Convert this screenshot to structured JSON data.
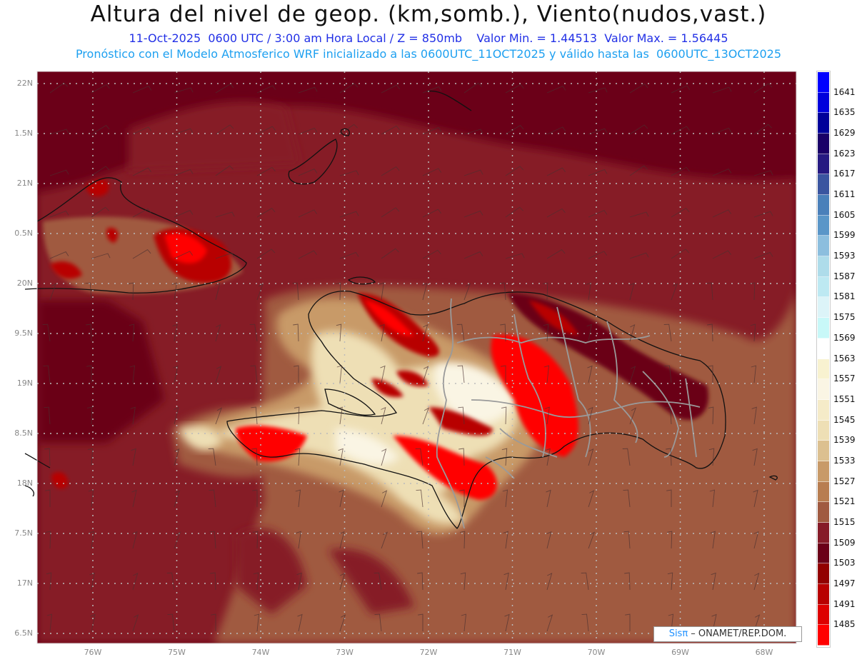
{
  "header": {
    "title": "Altura del nivel de geop. (km,somb.), Viento(nudos,vast.)",
    "subtitle1": "11-Oct-2025  0600 UTC / 3:00 am Hora Local / Z = 850mb    Valor Min. = 1.44513  Valor Max. = 1.56445",
    "subtitle2": "Pronóstico con el Modelo Atmosferico WRF inicializado a las 0600UTC_11OCT2025 y válido hasta las  0600UTC_13OCT2025"
  },
  "map": {
    "lat_labels": [
      {
        "lat": 22,
        "text": "22N"
      },
      {
        "lat": 21.5,
        "text": "1.5N"
      },
      {
        "lat": 21,
        "text": "21N"
      },
      {
        "lat": 20.5,
        "text": "0.5N"
      },
      {
        "lat": 20,
        "text": "20N"
      },
      {
        "lat": 19.5,
        "text": "9.5N"
      },
      {
        "lat": 19,
        "text": "19N"
      },
      {
        "lat": 18.5,
        "text": "8.5N"
      },
      {
        "lat": 18,
        "text": "18N"
      },
      {
        "lat": 17.5,
        "text": "7.5N"
      },
      {
        "lat": 17,
        "text": "17N"
      },
      {
        "lat": 16.5,
        "text": "6.5N"
      }
    ],
    "lon_labels": [
      {
        "lon": -76,
        "text": "76W"
      },
      {
        "lon": -75,
        "text": "75W"
      },
      {
        "lon": -74,
        "text": "74W"
      },
      {
        "lon": -73,
        "text": "73W"
      },
      {
        "lon": -72,
        "text": "72W"
      },
      {
        "lon": -71,
        "text": "71W"
      },
      {
        "lon": -70,
        "text": "70W"
      },
      {
        "lon": -69,
        "text": "69W"
      },
      {
        "lon": -68,
        "text": "68W"
      }
    ],
    "icon": "wind-barb-icon"
  },
  "colorbar": {
    "labels": [
      "1641",
      "1635",
      "1629",
      "1623",
      "1617",
      "1611",
      "1605",
      "1599",
      "1593",
      "1587",
      "1581",
      "1575",
      "1569",
      "1563",
      "1557",
      "1551",
      "1545",
      "1539",
      "1533",
      "1527",
      "1521",
      "1515",
      "1509",
      "1503",
      "1497",
      "1491",
      "1485"
    ],
    "colors": [
      "#0000ff",
      "#0000dc",
      "#00009a",
      "#1a0068",
      "#261a82",
      "#3a55a0",
      "#4a80ba",
      "#5a96c8",
      "#8cbede",
      "#aedcea",
      "#bde9f2",
      "#dcf4f8",
      "#c8f8f8",
      "#ffffff",
      "#f8f2d0",
      "#faf5e4",
      "#f5ebc8",
      "#eedfb5",
      "#dcc090",
      "#c89a68",
      "#b87d50",
      "#a05a40",
      "#861b28",
      "#6b0018",
      "#920000",
      "#b80000",
      "#dd0000",
      "#ff0000"
    ]
  },
  "credit": {
    "brand": "Sisπ",
    "text": " –  ONAMET/REP.DOM."
  }
}
